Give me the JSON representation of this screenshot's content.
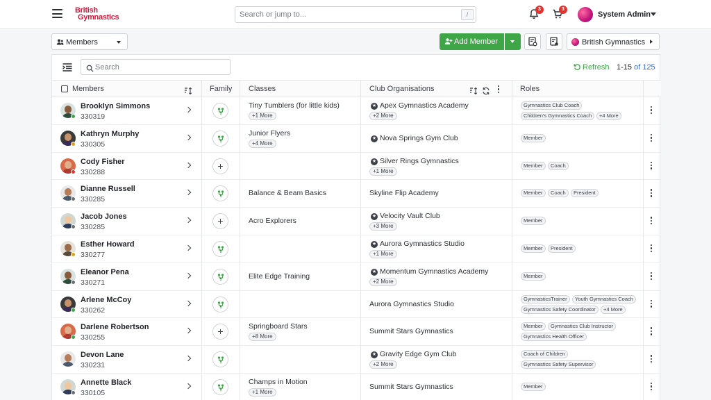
{
  "header": {
    "logo_line1": "British",
    "logo_line2": "Gymnastics",
    "search_placeholder": "Search or jump to...",
    "search_shortcut": "/",
    "notifications_count": "3",
    "cart_count": "3",
    "user_name": "System Admin"
  },
  "toolbar": {
    "view_select": "Members",
    "add_member_label": "Add Member",
    "org_select": "British Gymnastics"
  },
  "list": {
    "search_placeholder": "Search",
    "refresh_label": "Refresh",
    "pager_range": "1-15",
    "pager_of": "of 125"
  },
  "columns": {
    "members": "Members",
    "family": "Family",
    "classes": "Classes",
    "clubs": "Club Organisations",
    "roles": "Roles"
  },
  "colors": {
    "accent_green": "#3fa648",
    "brand_red": "#d4173a",
    "badge_red": "#e5322d"
  },
  "rows": [
    {
      "name": "Brooklyn Simmons",
      "id": "330319",
      "status": "green",
      "family": "linked",
      "class": "Tiny Tumblers (for little kids)",
      "class_more": "+1 More",
      "club": "Apex Gymnastics Academy",
      "club_star": true,
      "club_more": "+2 More",
      "roles": [
        "Gymnastics Club Coach",
        "Children's Gymnastics Coach",
        "+4 More"
      ]
    },
    {
      "name": "Kathryn Murphy",
      "id": "330305",
      "status": "yellow",
      "family": "linked",
      "class": "Junior Flyers",
      "class_more": "+4 More",
      "club": "Nova Springs Gym Club",
      "club_star": true,
      "club_more": "",
      "roles": [
        "Member"
      ]
    },
    {
      "name": "Cody Fisher",
      "id": "330288",
      "status": "red",
      "family": "add",
      "class": "",
      "class_more": "",
      "club": "Silver Rings Gymnastics",
      "club_star": true,
      "club_more": "+1 More",
      "roles": [
        "Member",
        "Coach"
      ]
    },
    {
      "name": "Dianne Russell",
      "id": "330285",
      "status": "grey",
      "family": "linked",
      "class": "Balance & Beam Basics",
      "class_more": "",
      "club": "Skyline Flip Academy",
      "club_star": false,
      "club_more": "",
      "roles": [
        "Member",
        "Coach",
        "President"
      ]
    },
    {
      "name": "Jacob Jones",
      "id": "330285",
      "status": "grey",
      "family": "add",
      "class": "Acro Explorers",
      "class_more": "",
      "club": "Velocity Vault Club",
      "club_star": true,
      "club_more": "+3 More",
      "roles": [
        "Member"
      ]
    },
    {
      "name": "Esther Howard",
      "id": "330277",
      "status": "yellow",
      "family": "linked",
      "class": "",
      "class_more": "",
      "club": "Aurora Gymnastics Studio",
      "club_star": true,
      "club_more": "+1 More",
      "roles": [
        "Member",
        "President"
      ]
    },
    {
      "name": "Eleanor Pena",
      "id": "330271",
      "status": "grey",
      "family": "linked",
      "class": "Elite Edge Training",
      "class_more": "",
      "club": "Momentum Gymnastics Academy",
      "club_star": true,
      "club_more": "+2 More",
      "roles": [
        "Member"
      ]
    },
    {
      "name": "Arlene McCoy",
      "id": "330262",
      "status": "green",
      "family": "linked",
      "class": "",
      "class_more": "",
      "club": "Aurora Gymnastics Studio",
      "club_star": false,
      "club_more": "",
      "roles": [
        "GymnasticsTrainer",
        "Youth Gymnastics Coach",
        "Gymnastics Safety Coordinator",
        "+4 More"
      ]
    },
    {
      "name": "Darlene Robertson",
      "id": "330255",
      "status": "green",
      "family": "add",
      "class": "Springboard Stars",
      "class_more": "+8 More",
      "club": "Summit Stars Gymnastics",
      "club_star": false,
      "club_more": "",
      "roles": [
        "Member",
        "Gymnastics Club Instructor",
        "Gymnastics Health Officer"
      ]
    },
    {
      "name": "Devon Lane",
      "id": "330231",
      "status": "none",
      "family": "linked",
      "class": "",
      "class_more": "",
      "club": "Gravity Edge Gym Club",
      "club_star": true,
      "club_more": "+2 More",
      "roles": [
        "Coach of Children",
        "Gymnastics Safety Supervisor"
      ]
    },
    {
      "name": "Annette Black",
      "id": "330105",
      "status": "grey",
      "family": "linked",
      "class": "Champs in Motion",
      "class_more": "+1 More",
      "club": "Summit Stars Gymnastics",
      "club_star": false,
      "club_more": "",
      "roles": [
        "Member"
      ]
    }
  ]
}
